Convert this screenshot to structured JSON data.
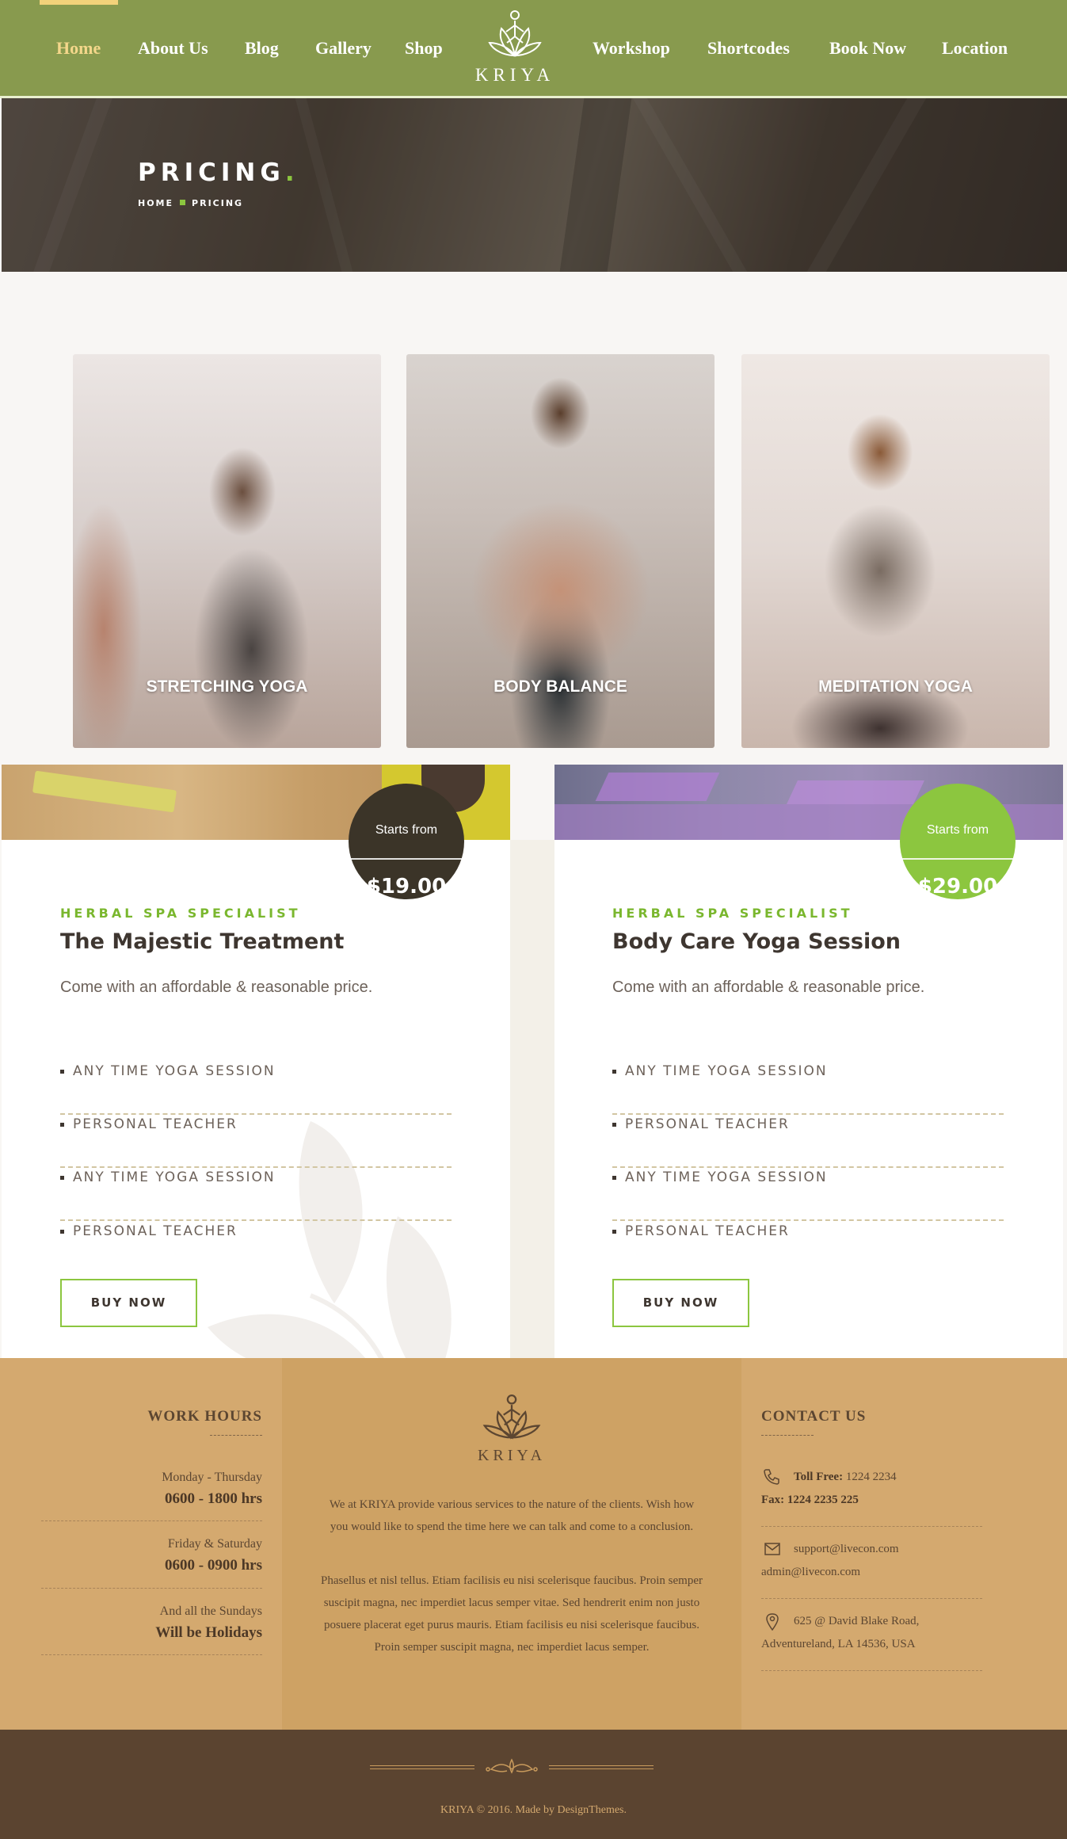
{
  "nav": {
    "items": [
      "Home",
      "About Us",
      "Blog",
      "Gallery",
      "Shop",
      "Workshop",
      "Shortcodes",
      "Book Now",
      "Location"
    ],
    "active": "Home",
    "logo_text": "KRIYA"
  },
  "hero": {
    "title": "PRICING",
    "title_dot": ".",
    "breadcrumb": [
      "HOME",
      "PRICING"
    ]
  },
  "cards": [
    {
      "label": "STRETCHING YOGA"
    },
    {
      "label": "BODY BALANCE"
    },
    {
      "label": "MEDITATION YOGA"
    }
  ],
  "pricing": [
    {
      "starts_label": "Starts from",
      "price": "$19.00",
      "subtitle": "HERBAL SPA SPECIALIST",
      "title": "The Majestic Treatment",
      "description": "Come with an affordable & reasonable price.",
      "features": [
        "ANY TIME YOGA SESSION",
        "PERSONAL TEACHER",
        "ANY TIME YOGA SESSION",
        "PERSONAL TEACHER"
      ],
      "button": "BUY NOW",
      "badge_color": "#3b3428"
    },
    {
      "starts_label": "Starts from",
      "price": "$29.00",
      "subtitle": "HERBAL SPA SPECIALIST",
      "title": "Body Care Yoga Session",
      "description": "Come with an affordable & reasonable price.",
      "features": [
        "ANY TIME YOGA SESSION",
        "PERSONAL TEACHER",
        "ANY TIME YOGA SESSION",
        "PERSONAL TEACHER"
      ],
      "button": "BUY NOW",
      "badge_color": "#8cc63f"
    }
  ],
  "footer": {
    "work_hours": {
      "heading": "WORK HOURS",
      "rows": [
        {
          "day": "Monday - Thursday",
          "hours": "0600 - 1800 hrs"
        },
        {
          "day": "Friday & Saturday",
          "hours": "0600 - 0900 hrs"
        },
        {
          "day": "And all the Sundays",
          "hours": "Will be Holidays"
        }
      ]
    },
    "about": {
      "logo_text": "KRIYA",
      "para1": "We at KRIYA provide various services to the nature of the clients. Wish how you would like to spend the time here we can talk and come to a conclusion.",
      "para2": "Phasellus et nisl tellus. Etiam facilisis eu nisi scelerisque faucibus. Proin semper suscipit magna, nec imperdiet lacus semper vitae. Sed hendrerit enim non justo posuere placerat eget purus mauris. Etiam facilisis eu nisi scelerisque faucibus. Proin semper suscipit magna, nec imperdiet lacus semper."
    },
    "contact": {
      "heading": "CONTACT US",
      "toll_free_label": "Toll Free:",
      "toll_free": "1224 2234",
      "fax": "Fax: 1224 2235 225",
      "email1": "support@livecon.com",
      "email2": "admin@livecon.com",
      "address1": "625 @ David Blake Road,",
      "address2": "Adventureland, LA 14536, USA"
    },
    "copyright": "KRIYA © 2016. Made by DesignThemes."
  },
  "colors": {
    "header_green": "#889a4e",
    "accent_green": "#8cc63f",
    "footer_tan": "#d4a96f",
    "footer_dark": "#5b4430"
  }
}
